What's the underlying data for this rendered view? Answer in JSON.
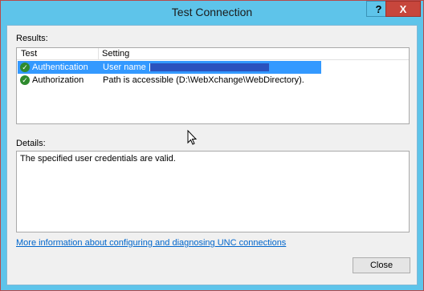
{
  "window": {
    "title": "Test Connection",
    "help_label": "?",
    "close_label": "X"
  },
  "results": {
    "label": "Results:",
    "columns": [
      "Test",
      "Setting"
    ],
    "rows": [
      {
        "test": "Authentication",
        "setting": "User name",
        "selected": true,
        "status_icon": "check-icon"
      },
      {
        "test": "Authorization",
        "setting": "Path is accessible (D:\\WebXchange\\WebDirectory).",
        "selected": false,
        "status_icon": "check-icon"
      }
    ]
  },
  "details": {
    "label": "Details:",
    "text": "The specified user credentials are valid."
  },
  "link_text": "More information about configuring and diagnosing UNC connections",
  "close_button_label": "Close",
  "colors": {
    "titlebar": "#5ec4ea",
    "selection": "#3399ff",
    "link": "#0066cc",
    "close_titlebar": "#c7463c"
  }
}
